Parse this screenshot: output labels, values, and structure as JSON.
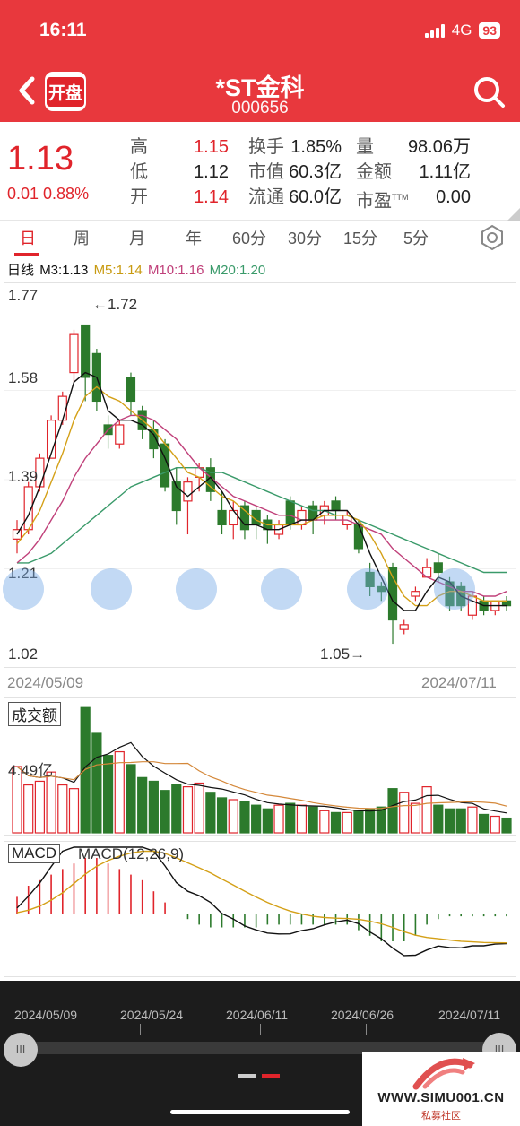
{
  "status": {
    "time": "16:11",
    "network": "4G",
    "battery": "93"
  },
  "header": {
    "name": "*ST金科",
    "code": "000656",
    "logo_label": "开盘"
  },
  "quote": {
    "price": "1.13",
    "change": "0.01 0.88%",
    "stats": [
      {
        "label": "高",
        "value": "1.15",
        "label2": "换手",
        "value2": "1.85%",
        "label3": "量",
        "value3": "98.06万"
      },
      {
        "label": "低",
        "value": "1.12",
        "label2": "市值",
        "value2": "60.3亿",
        "label3": "金额",
        "value3": "1.11亿"
      },
      {
        "label": "开",
        "value": "1.14",
        "label2": "流通",
        "value2": "60.0亿",
        "label3": "市盈",
        "value3": "0.00"
      }
    ],
    "ttm": "TTM"
  },
  "tabs": [
    "日",
    "周",
    "月",
    "年",
    "60分",
    "30分",
    "15分",
    "5分"
  ],
  "ma_legend": {
    "period": "日线",
    "m3": "M3:1.13",
    "m5": "M5:1.14",
    "m10": "M10:1.16",
    "m20": "M20:1.20"
  },
  "colors": {
    "up": "#e0242b",
    "down": "#2c7a2c",
    "m3": "#111111",
    "m5": "#d4a017",
    "m10": "#c0407a",
    "m20": "#3a9a6a"
  },
  "chart_data": {
    "type": "candlestick",
    "y_ticks": [
      "1.77",
      "1.58",
      "1.39",
      "1.21",
      "1.02"
    ],
    "ylim": [
      1.02,
      1.77
    ],
    "start_date": "2024/05/09",
    "end_date": "2024/07/11",
    "high_annotation": "1.72",
    "low_annotation": "1.05",
    "candles": [
      [
        1.27,
        1.29,
        1.24,
        1.31
      ],
      [
        1.29,
        1.38,
        1.28,
        1.39
      ],
      [
        1.38,
        1.44,
        1.37,
        1.45
      ],
      [
        1.44,
        1.52,
        1.44,
        1.53
      ],
      [
        1.52,
        1.57,
        1.51,
        1.58
      ],
      [
        1.62,
        1.7,
        1.6,
        1.71
      ],
      [
        1.72,
        1.61,
        1.56,
        1.72
      ],
      [
        1.66,
        1.56,
        1.54,
        1.67
      ],
      [
        1.51,
        1.49,
        1.46,
        1.53
      ],
      [
        1.47,
        1.51,
        1.46,
        1.52
      ],
      [
        1.61,
        1.56,
        1.53,
        1.62
      ],
      [
        1.54,
        1.5,
        1.48,
        1.55
      ],
      [
        1.5,
        1.46,
        1.44,
        1.52
      ],
      [
        1.47,
        1.38,
        1.37,
        1.48
      ],
      [
        1.39,
        1.33,
        1.3,
        1.42
      ],
      [
        1.35,
        1.39,
        1.28,
        1.4
      ],
      [
        1.4,
        1.42,
        1.37,
        1.43
      ],
      [
        1.42,
        1.37,
        1.35,
        1.44
      ],
      [
        1.33,
        1.3,
        1.28,
        1.37
      ],
      [
        1.3,
        1.33,
        1.27,
        1.35
      ],
      [
        1.34,
        1.29,
        1.27,
        1.35
      ],
      [
        1.33,
        1.3,
        1.27,
        1.34
      ],
      [
        1.31,
        1.29,
        1.26,
        1.32
      ],
      [
        1.28,
        1.3,
        1.27,
        1.31
      ],
      [
        1.35,
        1.3,
        1.29,
        1.36
      ],
      [
        1.3,
        1.33,
        1.29,
        1.34
      ],
      [
        1.34,
        1.31,
        1.28,
        1.35
      ],
      [
        1.32,
        1.34,
        1.3,
        1.35
      ],
      [
        1.35,
        1.33,
        1.31,
        1.36
      ],
      [
        1.3,
        1.32,
        1.29,
        1.33
      ],
      [
        1.3,
        1.25,
        1.24,
        1.31
      ],
      [
        1.2,
        1.17,
        1.15,
        1.22
      ],
      [
        1.17,
        1.16,
        1.14,
        1.18
      ],
      [
        1.21,
        1.1,
        1.05,
        1.22
      ],
      [
        1.08,
        1.09,
        1.07,
        1.1
      ],
      [
        1.15,
        1.16,
        1.14,
        1.17
      ],
      [
        1.19,
        1.21,
        1.19,
        1.23
      ],
      [
        1.22,
        1.2,
        1.18,
        1.24
      ],
      [
        1.18,
        1.13,
        1.12,
        1.19
      ],
      [
        1.17,
        1.13,
        1.12,
        1.18
      ],
      [
        1.11,
        1.15,
        1.1,
        1.16
      ],
      [
        1.14,
        1.12,
        1.11,
        1.15
      ],
      [
        1.12,
        1.14,
        1.11,
        1.14
      ],
      [
        1.14,
        1.13,
        1.12,
        1.15
      ]
    ],
    "ma3": [
      1.28,
      1.32,
      1.38,
      1.45,
      1.52,
      1.6,
      1.62,
      1.61,
      1.54,
      1.52,
      1.52,
      1.51,
      1.49,
      1.44,
      1.38,
      1.36,
      1.38,
      1.4,
      1.37,
      1.33,
      1.3,
      1.3,
      1.29,
      1.29,
      1.3,
      1.31,
      1.31,
      1.33,
      1.33,
      1.33,
      1.3,
      1.24,
      1.19,
      1.14,
      1.12,
      1.12,
      1.16,
      1.19,
      1.18,
      1.15,
      1.14,
      1.13,
      1.13,
      1.13
    ],
    "ma5": [
      1.26,
      1.29,
      1.33,
      1.39,
      1.45,
      1.52,
      1.57,
      1.59,
      1.57,
      1.56,
      1.54,
      1.52,
      1.5,
      1.47,
      1.44,
      1.41,
      1.4,
      1.38,
      1.36,
      1.35,
      1.33,
      1.31,
      1.3,
      1.3,
      1.3,
      1.3,
      1.31,
      1.32,
      1.32,
      1.32,
      1.31,
      1.28,
      1.24,
      1.19,
      1.15,
      1.13,
      1.13,
      1.15,
      1.16,
      1.16,
      1.15,
      1.14,
      1.14,
      1.14
    ],
    "ma10": [
      1.22,
      1.24,
      1.27,
      1.31,
      1.35,
      1.4,
      1.44,
      1.47,
      1.5,
      1.52,
      1.53,
      1.53,
      1.52,
      1.5,
      1.48,
      1.45,
      1.42,
      1.4,
      1.38,
      1.36,
      1.35,
      1.34,
      1.33,
      1.32,
      1.32,
      1.31,
      1.31,
      1.31,
      1.31,
      1.31,
      1.3,
      1.29,
      1.28,
      1.25,
      1.23,
      1.21,
      1.19,
      1.18,
      1.17,
      1.16,
      1.16,
      1.15,
      1.15,
      1.16
    ],
    "ma20": [
      1.22,
      1.22,
      1.23,
      1.24,
      1.26,
      1.28,
      1.3,
      1.32,
      1.34,
      1.36,
      1.38,
      1.39,
      1.4,
      1.41,
      1.42,
      1.42,
      1.42,
      1.41,
      1.41,
      1.4,
      1.39,
      1.38,
      1.37,
      1.36,
      1.35,
      1.34,
      1.33,
      1.33,
      1.32,
      1.32,
      1.31,
      1.3,
      1.29,
      1.28,
      1.27,
      1.26,
      1.25,
      1.24,
      1.23,
      1.22,
      1.21,
      1.2,
      1.2,
      1.2
    ],
    "volume_label": "成交额",
    "volume_tick": "4.49亿",
    "volume": [
      3.6,
      2.6,
      2.8,
      3.3,
      2.6,
      2.4,
      6.8,
      5.4,
      4.2,
      4.4,
      3.7,
      3.0,
      2.8,
      2.3,
      2.6,
      2.5,
      2.7,
      2.2,
      1.9,
      1.8,
      1.7,
      1.5,
      1.3,
      1.5,
      1.6,
      1.5,
      1.4,
      1.2,
      1.1,
      1.1,
      1.2,
      1.3,
      1.4,
      2.4,
      2.2,
      1.6,
      2.5,
      1.5,
      1.3,
      1.3,
      1.4,
      1.0,
      0.9,
      0.8
    ],
    "macd_label": "MACD",
    "macd_params": "MACD(12,26,9)",
    "macd_hist": [
      0.03,
      0.05,
      0.06,
      0.07,
      0.08,
      0.09,
      0.1,
      0.1,
      0.09,
      0.08,
      0.07,
      0.06,
      0.04,
      0.02,
      0.0,
      -0.01,
      -0.02,
      -0.025,
      -0.025,
      -0.025,
      -0.025,
      -0.025,
      -0.02,
      -0.02,
      -0.02,
      -0.02,
      -0.02,
      -0.02,
      -0.02,
      -0.02,
      -0.03,
      -0.04,
      -0.05,
      -0.05,
      -0.05,
      -0.04,
      -0.02,
      -0.01,
      -0.005,
      -0.005,
      -0.005,
      -0.005,
      -0.005,
      -0.005
    ]
  },
  "navigator": {
    "dates": [
      "2024/05/09",
      "2024/05/24",
      "2024/06/11",
      "2024/06/26",
      "2024/07/11"
    ],
    "handle_label": "III"
  },
  "watermark": {
    "text": "WWW.SIMU001.CN",
    "sub": "私募社区"
  }
}
